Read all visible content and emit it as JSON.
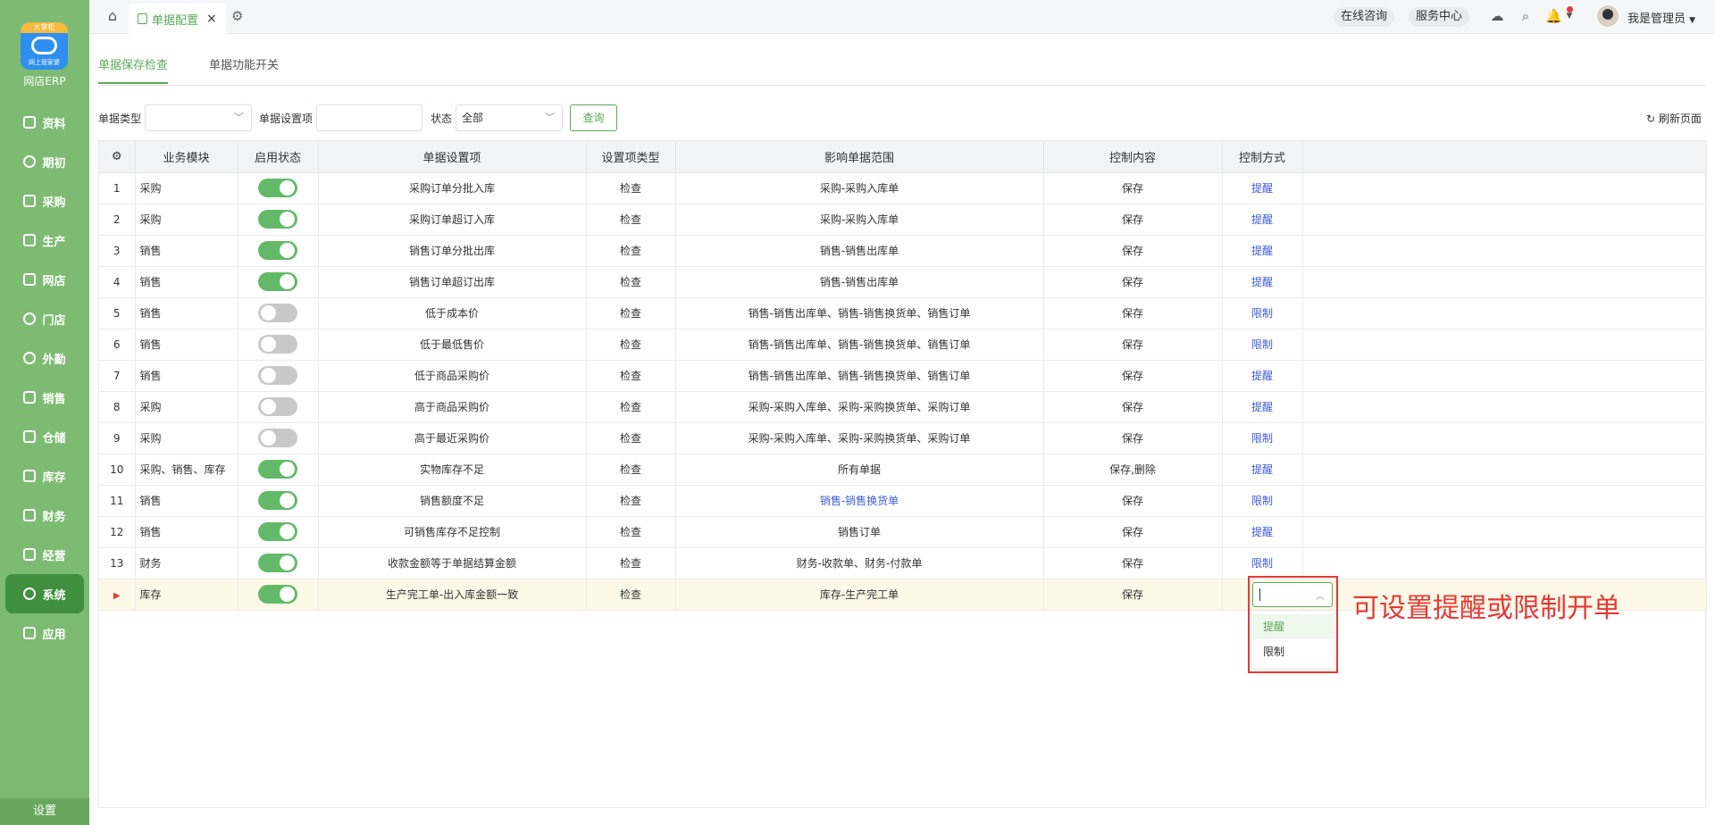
{
  "brand": {
    "badge": "大掌柜",
    "sub": "网上管家婆",
    "name": "网店ERP"
  },
  "nav": [
    {
      "label": "资料",
      "icon": "database-icon"
    },
    {
      "label": "期初",
      "icon": "clock-icon"
    },
    {
      "label": "采购",
      "icon": "cart-icon"
    },
    {
      "label": "生产",
      "icon": "factory-icon"
    },
    {
      "label": "网店",
      "icon": "store-icon"
    },
    {
      "label": "门店",
      "icon": "pie-icon"
    },
    {
      "label": "外勤",
      "icon": "target-icon"
    },
    {
      "label": "销售",
      "icon": "chart-icon"
    },
    {
      "label": "仓储",
      "icon": "warehouse-icon"
    },
    {
      "label": "库存",
      "icon": "home-icon"
    },
    {
      "label": "财务",
      "icon": "wallet-icon"
    },
    {
      "label": "经营",
      "icon": "trend-icon"
    },
    {
      "label": "系统",
      "icon": "gear-icon"
    },
    {
      "label": "应用",
      "icon": "plus-icon"
    }
  ],
  "sidebar_footer": "设置",
  "topbar": {
    "tab_label": "单据配置",
    "consult": "在线咨询",
    "service": "服务中心",
    "user": "我是管理员"
  },
  "page_tabs": [
    "单据保存检查",
    "单据功能开关"
  ],
  "filters": {
    "type_label": "单据类型",
    "item_label": "单据设置项",
    "status_label": "状态",
    "status_value": "全部",
    "query": "查询",
    "refresh": "刷新页面"
  },
  "table": {
    "headers": [
      "业务模块",
      "启用状态",
      "单据设置项",
      "设置项类型",
      "影响单据范围",
      "控制内容",
      "控制方式"
    ],
    "rows": [
      {
        "no": "1",
        "module": "采购",
        "enabled": true,
        "item": "采购订单分批入库",
        "type": "检查",
        "scope": "采购-采购入库单",
        "content": "保存",
        "mode": "提醒"
      },
      {
        "no": "2",
        "module": "采购",
        "enabled": true,
        "item": "采购订单超订入库",
        "type": "检查",
        "scope": "采购-采购入库单",
        "content": "保存",
        "mode": "提醒"
      },
      {
        "no": "3",
        "module": "销售",
        "enabled": true,
        "item": "销售订单分批出库",
        "type": "检查",
        "scope": "销售-销售出库单",
        "content": "保存",
        "mode": "提醒"
      },
      {
        "no": "4",
        "module": "销售",
        "enabled": true,
        "item": "销售订单超订出库",
        "type": "检查",
        "scope": "销售-销售出库单",
        "content": "保存",
        "mode": "提醒"
      },
      {
        "no": "5",
        "module": "销售",
        "enabled": false,
        "item": "低于成本价",
        "type": "检查",
        "scope": "销售-销售出库单、销售-销售换货单、销售订单",
        "content": "保存",
        "mode": "限制"
      },
      {
        "no": "6",
        "module": "销售",
        "enabled": false,
        "item": "低于最低售价",
        "type": "检查",
        "scope": "销售-销售出库单、销售-销售换货单、销售订单",
        "content": "保存",
        "mode": "限制"
      },
      {
        "no": "7",
        "module": "销售",
        "enabled": false,
        "item": "低于商品采购价",
        "type": "检查",
        "scope": "销售-销售出库单、销售-销售换货单、销售订单",
        "content": "保存",
        "mode": "提醒"
      },
      {
        "no": "8",
        "module": "采购",
        "enabled": false,
        "item": "高于商品采购价",
        "type": "检查",
        "scope": "采购-采购入库单、采购-采购换货单、采购订单",
        "content": "保存",
        "mode": "提醒"
      },
      {
        "no": "9",
        "module": "采购",
        "enabled": false,
        "item": "高于最近采购价",
        "type": "检查",
        "scope": "采购-采购入库单、采购-采购换货单、采购订单",
        "content": "保存",
        "mode": "限制"
      },
      {
        "no": "10",
        "module": "采购、销售、库存",
        "enabled": true,
        "item": "实物库存不足",
        "type": "检查",
        "scope": "所有单据",
        "content": "保存,删除",
        "mode": "提醒"
      },
      {
        "no": "11",
        "module": "销售",
        "enabled": true,
        "item": "销售额度不足",
        "type": "检查",
        "scope": "销售-销售换货单",
        "content": "保存",
        "mode": "限制"
      },
      {
        "no": "12",
        "module": "销售",
        "enabled": true,
        "item": "可销售库存不足控制",
        "type": "检查",
        "scope": "销售订单",
        "content": "保存",
        "mode": "提醒"
      },
      {
        "no": "13",
        "module": "财务",
        "enabled": true,
        "item": "收款金额等于单据结算金额",
        "type": "检查",
        "scope": "财务-收款单、财务-付款单",
        "content": "保存",
        "mode": "限制"
      },
      {
        "no": "",
        "module": "库存",
        "enabled": true,
        "item": "生产完工单-出入库金额一致",
        "type": "检查",
        "scope": "库存-生产完工单",
        "content": "保存",
        "mode": ""
      }
    ]
  },
  "dropdown": {
    "options": [
      "提醒",
      "限制"
    ],
    "highlighted": "提醒"
  },
  "callout": "可设置提醒或限制开单"
}
